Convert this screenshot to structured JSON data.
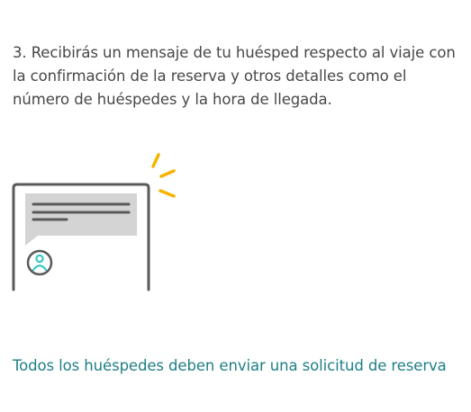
{
  "step": {
    "text": "3. Recibirás un mensaje de tu huésped respecto al viaje con la confirmación de la reserva y otros detalles como el número de huéspedes y la hora de llegada."
  },
  "illustration": {
    "icon": "message-notification-icon",
    "colors": {
      "frame": "#5a5a5a",
      "bubble": "#d4d4d4",
      "text_lines": "#5a5a5a",
      "notify": "#f5b400",
      "avatar": "#3cc7c7"
    }
  },
  "footer": {
    "link_text": "Todos los huéspedes deben enviar una solicitud de reserva",
    "link_color": "#1e7f86"
  }
}
